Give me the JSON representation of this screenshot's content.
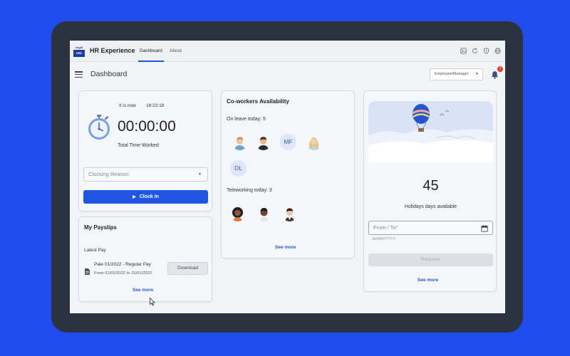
{
  "app": {
    "logo_top": "cegid",
    "logo_bottom": "HRE",
    "title": "HR Experience",
    "tabs": [
      {
        "label": "Dashboard",
        "active": true
      },
      {
        "label": "About",
        "active": false
      }
    ]
  },
  "toolbar_icons": [
    "image-icon",
    "refresh-icon",
    "shield-icon",
    "globe-icon"
  ],
  "header": {
    "page_title": "Dashboard",
    "role_select": "Employee/Manager",
    "notification_count": "7"
  },
  "clock_card": {
    "it_is_now_label": "It is now",
    "current_time": "16:23:18",
    "timer": "00:00:00",
    "total_label": "Total Time Worked",
    "reason_placeholder": "Clocking Reason",
    "clock_in_label": "Clock In"
  },
  "payslips_card": {
    "title": "My Payslips",
    "latest_label": "Latest Pay",
    "payslip_title": "Paie 01/2022 - Regular Pay",
    "payslip_range": "From 01/01/2022 to 31/01/2022",
    "download_label": "Download",
    "see_more": "See more"
  },
  "coworkers_card": {
    "title": "Co-workers Availability",
    "on_leave_label": "On leave today: 5",
    "on_leave_initials": [
      "MF",
      "DL"
    ],
    "teleworking_label": "Teleworking today: 3",
    "see_more": "See more"
  },
  "holidays_card": {
    "days": "45",
    "days_label": "Holidays days available",
    "date_placeholder": "From / To*",
    "date_hint": "dd/MM/YYYY",
    "request_label": "Request",
    "see_more": "See more"
  },
  "colors": {
    "background": "#1f4cea",
    "accent": "#1f55e0",
    "link": "#2454d6",
    "badge": "#e53935"
  }
}
